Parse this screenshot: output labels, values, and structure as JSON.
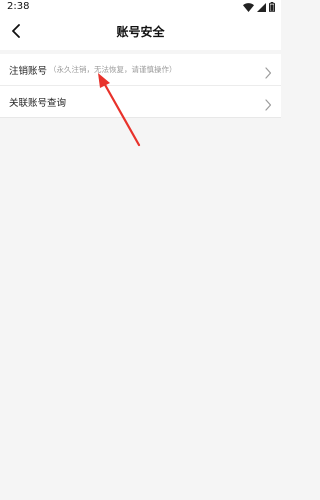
{
  "status_bar": {
    "time": "2:38",
    "icons": [
      "wifi-icon",
      "signal-icon",
      "battery-icon"
    ]
  },
  "header": {
    "title": "账号安全",
    "back_icon": "back-arrow-icon"
  },
  "settings": {
    "items": [
      {
        "label": "注销账号",
        "hint": "（永久注销，无法恢复，请谨慎操作）",
        "icon": "chevron-right-icon"
      },
      {
        "label": "关联账号查询",
        "hint": "",
        "icon": "chevron-right-icon"
      }
    ]
  },
  "annotation": {
    "color": "#e8322b",
    "icon": "red-arrow-annotation"
  },
  "colors": {
    "background": "#f5f5f5",
    "surface": "#ffffff",
    "text": "#222222",
    "hint": "#9a9a9a",
    "chevron": "#9b9b9b",
    "annotation": "#e8322b"
  }
}
